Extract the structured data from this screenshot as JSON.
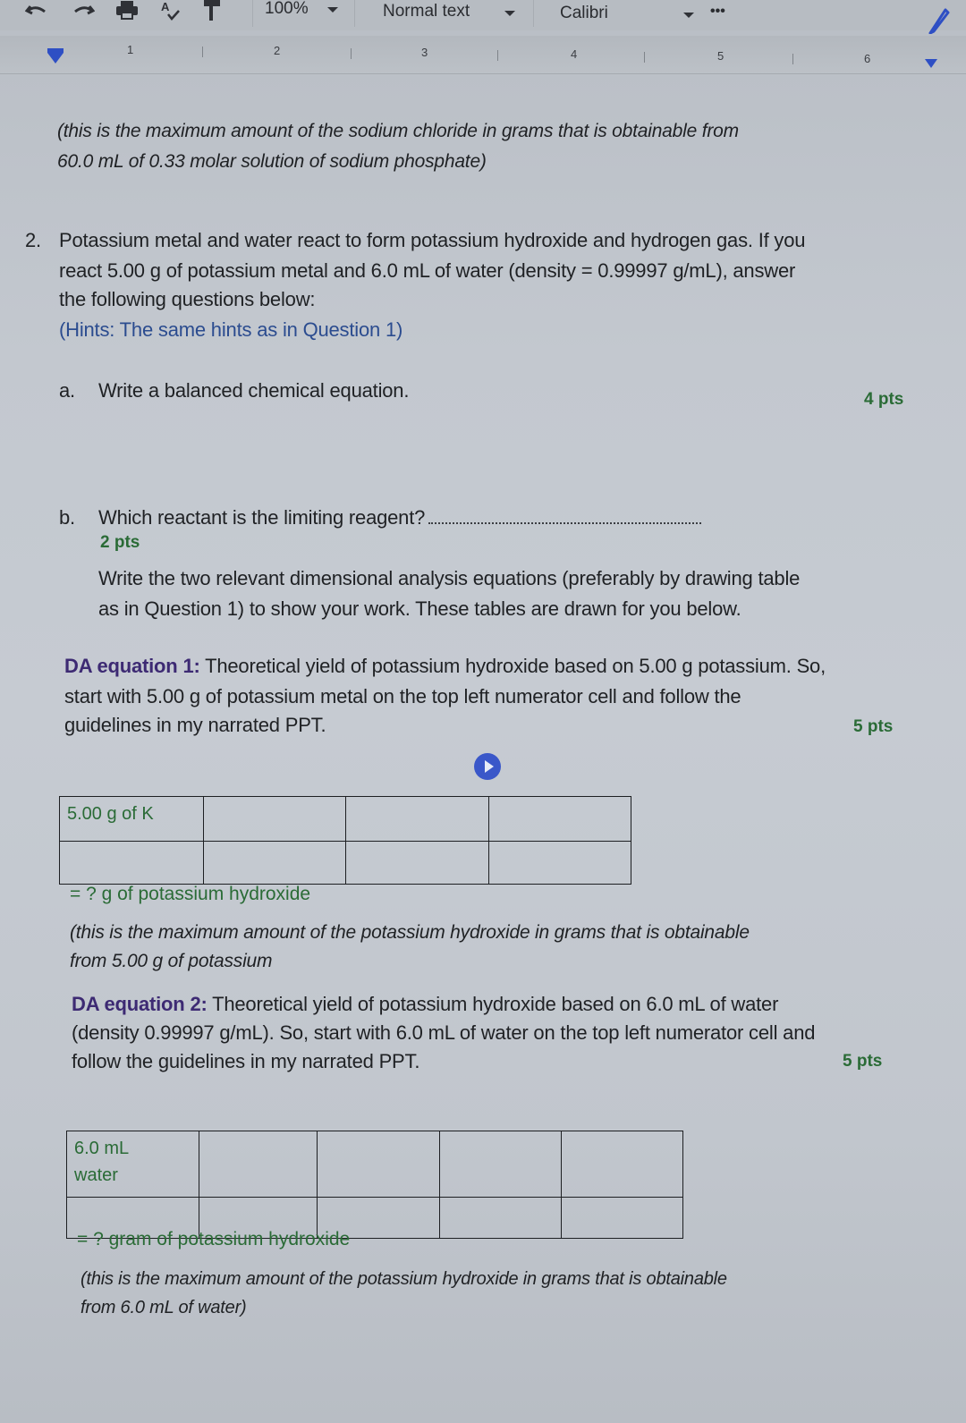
{
  "toolbar": {
    "zoom": "100%",
    "style": "Normal text",
    "font": "Calibri",
    "more": "•••",
    "icons": [
      "undo-icon",
      "redo-icon",
      "print-icon",
      "spellcheck-icon",
      "paint-format-icon",
      "pencil-icon"
    ]
  },
  "ruler": {
    "numbers": [
      "1",
      "2",
      "3",
      "4",
      "5",
      "6"
    ]
  },
  "document": {
    "prev_note_line1": "(this is the maximum amount of the sodium chloride in grams that is obtainable from",
    "prev_note_line2": "60.0 mL of 0.33 molar solution of sodium phosphate)",
    "q2": {
      "number": "2.",
      "line1": "Potassium metal and water react to form potassium hydroxide and hydrogen gas. If you",
      "line2": "react 5.00 g of potassium metal and 6.0 mL of water (density = 0.99997 g/mL), answer",
      "line3": "the following questions below:",
      "hint": "(Hints: The same hints as in Question 1)"
    },
    "part_a": {
      "letter": "a.",
      "text": "Write a balanced chemical equation.",
      "points": "4 pts"
    },
    "part_b": {
      "letter": "b.",
      "text": "Which reactant is the limiting reagent?",
      "points": "2 pts",
      "instr_line1": "Write the two relevant dimensional analysis equations (preferably by drawing table",
      "instr_line2": "as in Question 1) to show your work. These tables are drawn for you below."
    },
    "da1": {
      "label": "DA equation 1:",
      "line1": " Theoretical yield of potassium hydroxide based on 5.00 g potassium. So,",
      "line2": "start with 5.00 g of potassium metal on the top left numerator cell and follow the",
      "line3": "guidelines in my narrated PPT.",
      "points": "5 pts",
      "table": {
        "rows": [
          [
            "5.00 g of K",
            "",
            "",
            ""
          ],
          [
            "",
            "",
            "",
            ""
          ]
        ]
      },
      "result": "= ? g of potassium hydroxide",
      "note_line1": "(this is the maximum amount of the potassium hydroxide in grams that is obtainable",
      "note_line2": "from 5.00 g of potassium"
    },
    "da2": {
      "label": "DA equation 2:",
      "line1": " Theoretical yield of potassium hydroxide based on 6.0 mL of water",
      "line2": "(density 0.99997 g/mL). So, start with 6.0 mL of water on the top left numerator cell and",
      "line3": "follow the guidelines in my narrated PPT.",
      "points": "5 pts",
      "table": {
        "rows": [
          [
            "6.0 mL\nwater",
            "",
            "",
            "",
            ""
          ],
          [
            "",
            "",
            "",
            "",
            ""
          ]
        ]
      },
      "result": "= ? gram of potassium hydroxide",
      "note_line1": "(this is the maximum amount of the potassium hydroxide in grams that is obtainable",
      "note_line2": "from 6.0 mL of water)"
    }
  }
}
